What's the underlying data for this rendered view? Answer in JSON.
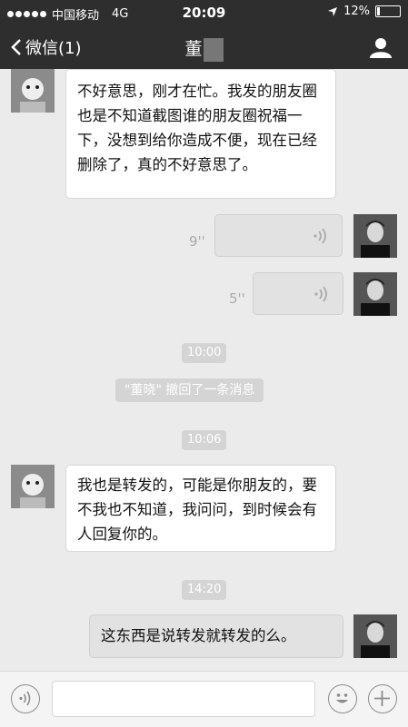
{
  "status_bar": {
    "carrier": "中国移动",
    "network": "4G",
    "time": "20:09",
    "battery": "12%",
    "battery_level": 0.12
  },
  "nav": {
    "back_label": "微信(1)",
    "title": "董"
  },
  "messages": [
    {
      "text": "不好意思，刚才在忙。我发的朋友圈也是不知道截图谁的朋友圈祝福一下，没想到给你造成不便，现在已经删除了，真的不好意思了。"
    },
    {
      "duration": "9''"
    },
    {
      "duration": "5''"
    },
    {
      "time": "10:00"
    },
    {
      "system": "\"董晓\" 撤回了一条消息"
    },
    {
      "time": "10:06"
    },
    {
      "text": "我也是转发的，可能是你朋友的，要不我也不知道，我问问，到时候会有人回复你的。"
    },
    {
      "time": "14:20"
    },
    {
      "text": "这东西是说转发就转发的么。"
    }
  ]
}
